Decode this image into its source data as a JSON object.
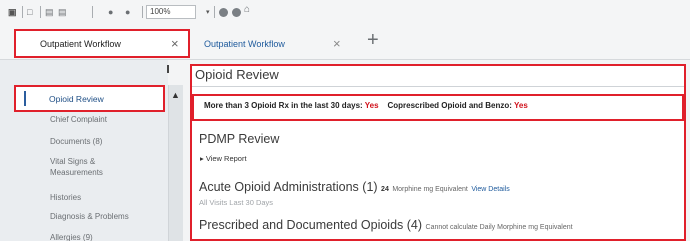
{
  "toolbar": {
    "zoom_value": "100%"
  },
  "tabs": [
    {
      "label": "Outpatient Workflow",
      "close": "×"
    },
    {
      "label": "Outpatient Workflow",
      "close": "×"
    }
  ],
  "add_tab": "+",
  "sidebar": {
    "selected": "Opioid Review",
    "items": [
      "Chief Complaint",
      "Documents (8)",
      "Vital Signs &",
      "Measurements",
      "Histories",
      "Diagnosis & Problems",
      "Allergies (9)"
    ]
  },
  "main": {
    "title": "Opioid Review",
    "alert": {
      "label1": "More than 3 Opioid Rx in the last 30 days:",
      "value1": "Yes",
      "label2": "Coprescribed Opioid and Benzo:",
      "value2": "Yes"
    },
    "pdmp": {
      "title": "PDMP Review",
      "link": "▸ View Report"
    },
    "acute": {
      "title": "Acute Opioid Administrations (1)",
      "mme_value": "24",
      "mme_label": "Morphine mg Equivalent",
      "link": "View Details",
      "subtitle": "All Visits Last 30 Days"
    },
    "prescribed": {
      "title": "Prescribed and Documented Opioids (4)",
      "note": "Cannot calculate Daily Morphine mg Equivalent"
    }
  },
  "colors": {
    "highlight_red": "#e0202b",
    "link_blue": "#1e5a9c",
    "yes_red": "#d0111b"
  }
}
